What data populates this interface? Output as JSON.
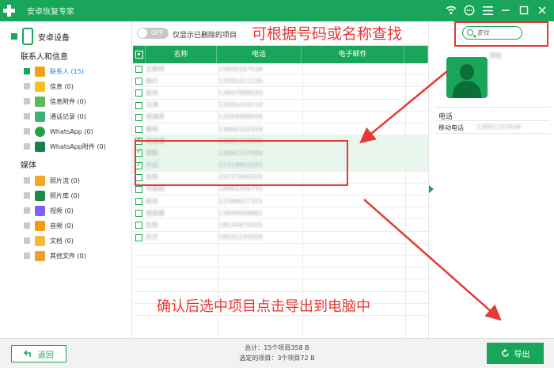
{
  "app": {
    "title": "安卓恢复专家"
  },
  "sidebar": {
    "device_label": "安卓设备",
    "section_contacts": "联系人和信息",
    "contacts_items": [
      {
        "label": "联系人 (15)",
        "color": "#f6a21e",
        "active": true
      },
      {
        "label": "信息 (0)",
        "color": "#f6c21e"
      },
      {
        "label": "信息附件 (0)",
        "color": "#5cb85c"
      },
      {
        "label": "通话记录 (0)",
        "color": "#3cb371"
      },
      {
        "label": "WhatsApp (0)",
        "color": "#25a244"
      },
      {
        "label": "WhatsApp附件 (0)",
        "color": "#1b7f4a"
      }
    ],
    "section_media": "媒体",
    "media_items": [
      {
        "label": "照片流 (0)",
        "color": "#f5a623"
      },
      {
        "label": "照片库 (0)",
        "color": "#1b8a4c"
      },
      {
        "label": "视频 (0)",
        "color": "#7b61ff"
      },
      {
        "label": "音频 (0)",
        "color": "#f39c12"
      },
      {
        "label": "文档 (0)",
        "color": "#f5b841"
      },
      {
        "label": "其他文件 (0)",
        "color": "#f0a030"
      }
    ]
  },
  "main": {
    "toggle_state": "OFF",
    "toggle_label": "仅显示已删除的项目",
    "columns": [
      "名称",
      "电话",
      "电子邮件"
    ],
    "rows": [
      {
        "name": "王默然",
        "phone": "15800107538",
        "selected": false
      },
      {
        "name": "杨行",
        "phone": "13581011236",
        "selected": false
      },
      {
        "name": "吴炜",
        "phone": "13697898550",
        "selected": false
      },
      {
        "name": "冯涛",
        "phone": "13581010110",
        "selected": false
      },
      {
        "name": "胡海燕",
        "phone": "13569988500",
        "selected": false
      },
      {
        "name": "黄明",
        "phone": "13866102458",
        "selected": false
      },
      {
        "name": "周珊珊",
        "phone": "13482761995",
        "selected": true
      },
      {
        "name": "郑盼",
        "phone": "13991157934",
        "selected": true
      },
      {
        "name": "方远",
        "phone": "17319991505",
        "selected": true
      },
      {
        "name": "张阳",
        "phone": "15737648320",
        "selected": false
      },
      {
        "name": "许雨田",
        "phone": "18983356750",
        "selected": false
      },
      {
        "name": "韩尚",
        "phone": "13386617355",
        "selected": false
      },
      {
        "name": "钱丽娜",
        "phone": "13898009861",
        "selected": false
      },
      {
        "name": "彭辉",
        "phone": "18534879505",
        "selected": false
      },
      {
        "name": "孙文",
        "phone": "18501234508",
        "selected": false
      }
    ]
  },
  "annotations": {
    "search_hint": "可根据号码或名称查找",
    "export_hint": "确认后选中项目点击导出到电脑中"
  },
  "detail": {
    "search_placeholder": "查找",
    "contact_name": "郑盼",
    "phone_title": "电话",
    "mobile_label": "移动电话",
    "mobile_value": "13991157934"
  },
  "bottom": {
    "back_label": "返回",
    "total_text": "总计：15个项目358 B",
    "selected_text": "选定的项目：3个项目72 B",
    "export_label": "导出"
  },
  "colors": {
    "brand": "#19a55a",
    "annotation": "#e53935"
  }
}
